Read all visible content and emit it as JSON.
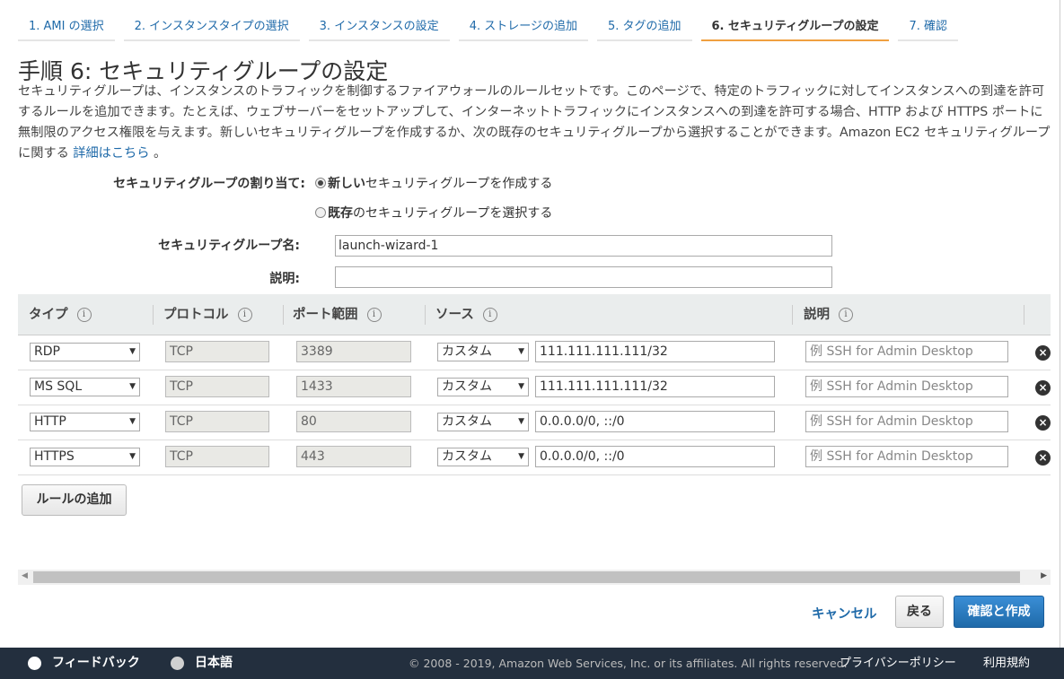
{
  "tabs": [
    {
      "label": "1. AMI の選択"
    },
    {
      "label": "2. インスタンスタイプの選択"
    },
    {
      "label": "3. インスタンスの設定"
    },
    {
      "label": "4. ストレージの追加"
    },
    {
      "label": "5. タグの追加"
    },
    {
      "label": "6. セキュリティグループの設定"
    },
    {
      "label": "7. 確認"
    }
  ],
  "page": {
    "title": "手順 6: セキュリティグループの設定",
    "description": "セキュリティグループは、インスタンスのトラフィックを制御するファイアウォールのルールセットです。このページで、特定のトラフィックに対してインスタンスへの到達を許可するルールを追加できます。たとえば、ウェブサーバーをセットアップして、インターネットトラフィックにインスタンスへの到達を許可する場合、HTTP および HTTPS ポートに無制限のアクセス権限を与えます。新しいセキュリティグループを作成するか、次の既存のセキュリティグループから選択することができます。Amazon EC2 セキュリティグループに関する",
    "learn_more": "詳細はこちら",
    "period": "。"
  },
  "form": {
    "assign_label": "セキュリティグループの割り当て:",
    "radio_new_bold": "新しい",
    "radio_new_rest": "セキュリティグループを作成する",
    "radio_existing_bold": "既存",
    "radio_existing_rest": "のセキュリティグループを選択する",
    "name_label": "セキュリティグループ名:",
    "name_value": "launch-wizard-1",
    "desc_label": "説明:",
    "desc_value": ""
  },
  "table": {
    "headers": {
      "type": "タイプ",
      "protocol": "プロトコル",
      "port": "ポート範囲",
      "source": "ソース",
      "description": "説明"
    },
    "info_glyph": "i",
    "rows": [
      {
        "type": "RDP",
        "protocol": "TCP",
        "port": "3389",
        "source_type": "カスタム",
        "source": "111.111.111.111/32",
        "description_placeholder": "例 SSH for Admin Desktop"
      },
      {
        "type": "MS SQL",
        "protocol": "TCP",
        "port": "1433",
        "source_type": "カスタム",
        "source": "111.111.111.111/32",
        "description_placeholder": "例 SSH for Admin Desktop"
      },
      {
        "type": "HTTP",
        "protocol": "TCP",
        "port": "80",
        "source_type": "カスタム",
        "source": "0.0.0.0/0, ::/0",
        "description_placeholder": "例 SSH for Admin Desktop"
      },
      {
        "type": "HTTPS",
        "protocol": "TCP",
        "port": "443",
        "source_type": "カスタム",
        "source": "0.0.0.0/0, ::/0",
        "description_placeholder": "例 SSH for Admin Desktop"
      }
    ]
  },
  "buttons": {
    "add_rule": "ルールの追加",
    "cancel": "キャンセル",
    "back": "戻る",
    "review_launch": "確認と作成"
  },
  "footer": {
    "feedback": "フィードバック",
    "language": "日本語",
    "copyright": "© 2008 - 2019, Amazon Web Services, Inc. or its affiliates. All rights reserved.",
    "privacy": "プライバシーポリシー",
    "terms": "利用規約"
  },
  "colors": {
    "link": "#1f6aa9",
    "active_tab_underline": "#f0a040",
    "footer_bg": "#232f3e",
    "primary_button": "#1f6aa9"
  }
}
